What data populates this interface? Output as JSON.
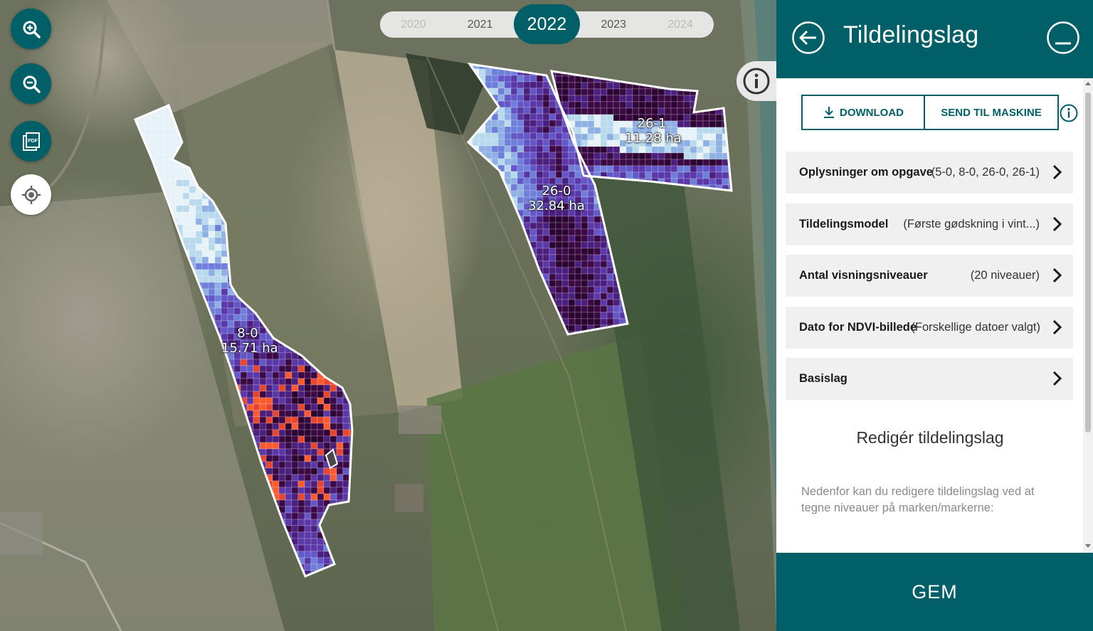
{
  "map": {
    "years": [
      {
        "label": "2020",
        "state": "dim"
      },
      {
        "label": "2021",
        "state": "normal"
      },
      {
        "label": "2022",
        "state": "active"
      },
      {
        "label": "2023",
        "state": "normal"
      },
      {
        "label": "2024",
        "state": "dim"
      }
    ],
    "fields": [
      {
        "id": "8-0",
        "area": "15.71 ha"
      },
      {
        "id": "26-0",
        "area": "32.84 ha"
      },
      {
        "id": "26-1",
        "area": "11.28 ha"
      }
    ],
    "controls": {
      "zoom_in_icon": "zoom-in-icon",
      "zoom_out_icon": "zoom-out-icon",
      "pdf_icon": "pdf-icon",
      "pdf_text": "PDF",
      "locate_icon": "locate-icon",
      "info_icon": "info-icon"
    }
  },
  "panel": {
    "title": "Tildelingslag",
    "download_label": "DOWNLOAD",
    "send_label": "SEND TIL MASKINE",
    "rows": [
      {
        "label": "Oplysninger om opgave",
        "value": "(5-0, 8-0, 26-0, 26-1)"
      },
      {
        "label": "Tildelingsmodel",
        "value": "(Første gødskning i vint...)"
      },
      {
        "label": "Antal visningsniveauer",
        "value": "(20 niveauer)"
      },
      {
        "label": "Dato for NDVI-billede",
        "value": "(Forskellige datoer valgt)"
      },
      {
        "label": "Basislag",
        "value": ""
      }
    ],
    "edit_title": "Redigér tildelingslag",
    "edit_description": "Nedenfor kan du redigere tildelingslag ved at tegne niveauer på marken/markerne:",
    "save_label": "GEM"
  },
  "colors": {
    "primary": "#005f67",
    "row_bg": "#f0f0f0",
    "heat_low": "#d8ecf4",
    "heat_mid": "#6b5ccf",
    "heat_high": "#3b0a45",
    "heat_hot": "#ff5a2e"
  }
}
